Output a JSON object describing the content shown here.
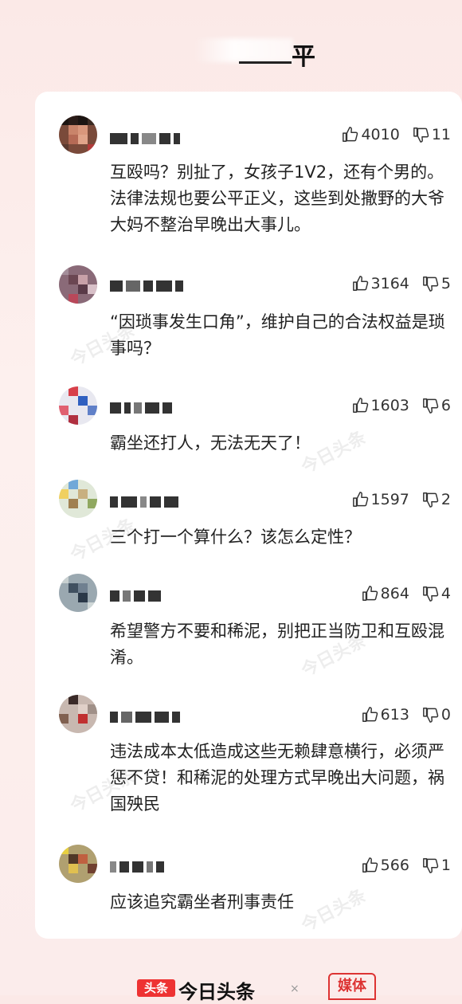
{
  "header": {
    "title": "平"
  },
  "comments": [
    {
      "likes": "4010",
      "dislikes": "11",
      "text": "互殴吗？别扯了，女孩子1V2，还有个男的。法律法规也要公平正义，这些到处撒野的大爷大妈不整治早晚出大事儿。"
    },
    {
      "likes": "3164",
      "dislikes": "5",
      "text": "“因琐事发生口角”，维护自己的合法权益是琐事吗？"
    },
    {
      "likes": "1603",
      "dislikes": "6",
      "text": "霸坐还打人，无法无天了！"
    },
    {
      "likes": "1597",
      "dislikes": "2",
      "text": "三个打一个算什么？该怎么定性？"
    },
    {
      "likes": "864",
      "dislikes": "4",
      "text": "希望警方不要和稀泥，别把正当防卫和互殴混淆。"
    },
    {
      "likes": "613",
      "dislikes": "0",
      "text": "违法成本太低造成这些无赖肆意横行，必须严惩不贷！和稀泥的处理方式早晚出大问题，祸国殃民"
    },
    {
      "likes": "566",
      "dislikes": "1",
      "text": "应该追究霸坐者刑事责任"
    }
  ],
  "watermark": "今日头条",
  "footer": {
    "badge": "头条",
    "brand": "今日头条",
    "separator": "×",
    "media": "媒体"
  },
  "colors": {
    "accent": "#e33333",
    "text": "#222222",
    "background": "#fbe9e7"
  },
  "icons": {
    "like": "thumbs-up-icon",
    "dislike": "thumbs-down-icon"
  }
}
